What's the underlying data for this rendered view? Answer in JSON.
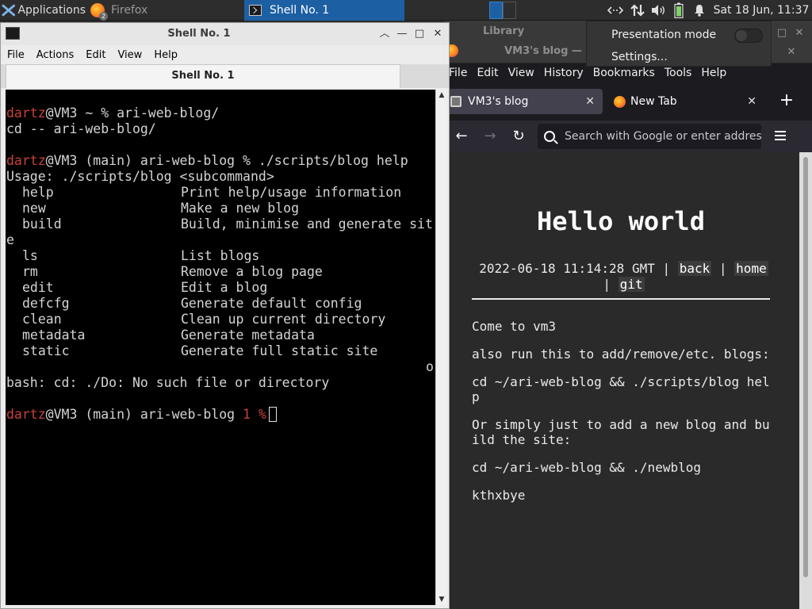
{
  "panel": {
    "applications_label": "Applications",
    "tasks": [
      {
        "label": "Firefox",
        "badge": "2"
      },
      {
        "label": "Shell No. 1"
      }
    ],
    "clock": "Sat 18 Jun, 11:37",
    "tray_icons": [
      "network-icon",
      "transfer-icon",
      "volume-icon",
      "battery-icon",
      "notification-bell-icon"
    ]
  },
  "popup": {
    "items": [
      "Presentation mode",
      "Settings..."
    ]
  },
  "terminal": {
    "window_title": "Shell No. 1",
    "menu": [
      "File",
      "Actions",
      "Edit",
      "View",
      "Help"
    ],
    "tab_label": "Shell No. 1",
    "lines": [
      {
        "user": "dartz",
        "rest": "@VM3 ~ % ari-web-blog/"
      },
      {
        "text": "cd -- ari-web-blog/"
      },
      {
        "text": ""
      },
      {
        "user": "dartz",
        "rest": "@VM3 (main) ari-web-blog % ./scripts/blog help"
      },
      {
        "text": "Usage: ./scripts/blog <subcommand>"
      }
    ],
    "help_rows": [
      {
        "cmd": "help",
        "desc": "Print help/usage information"
      },
      {
        "cmd": "new",
        "desc": "Make a new blog"
      },
      {
        "cmd": "build",
        "desc": "Build, minimise and generate sit"
      },
      {
        "wrap": "e"
      },
      {
        "cmd": "ls",
        "desc": "List blogs"
      },
      {
        "cmd": "rm",
        "desc": "Remove a blog page"
      },
      {
        "cmd": "edit",
        "desc": "Edit a blog"
      },
      {
        "cmd": "defcfg",
        "desc": "Generate default config"
      },
      {
        "cmd": "clean",
        "desc": "Clean up current directory"
      },
      {
        "cmd": "metadata",
        "desc": "Generate metadata"
      },
      {
        "cmd": "static",
        "desc": "Generate full static site"
      }
    ],
    "stray_char": "o",
    "error_line": "bash: cd: ./Do: No such file or directory",
    "prompt_user": "dartz",
    "prompt_rest": "@VM3 (main) ari-web-blog ",
    "prompt_status": "1 %"
  },
  "firefox": {
    "library_title": "Library",
    "window_title": "VM3's blog —",
    "menu": [
      "File",
      "Edit",
      "View",
      "History",
      "Bookmarks",
      "Tools",
      "Help"
    ],
    "tabs": [
      {
        "label": "VM3's blog"
      },
      {
        "label": "New Tab"
      }
    ],
    "url_placeholder": "Search with Google or enter address",
    "page": {
      "title": "Hello world",
      "meta_date": "2022-06-18 11:14:28 GMT | ",
      "links": [
        "back",
        "home",
        "git"
      ],
      "paragraphs": [
        "Come to vm3",
        "also run this to add/remove/etc. blogs:",
        "cd ~/ari-web-blog && ./scripts/blog help",
        "Or simply just to add a new blog and build the site:",
        "cd ~/ari-web-blog && ./newblog",
        "kthxbye"
      ]
    }
  }
}
